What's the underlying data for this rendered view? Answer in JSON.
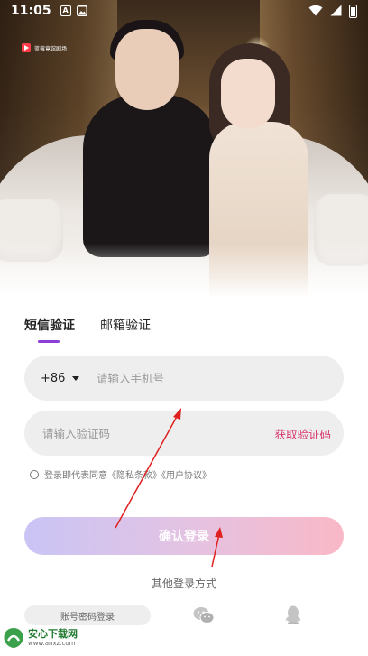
{
  "status_bar": {
    "time": "11:05",
    "app_icon_letter": "A"
  },
  "hero": {
    "brand_text": "蓝莓竟馆剧场"
  },
  "tabs": [
    {
      "label": "短信验证",
      "active": true
    },
    {
      "label": "邮箱验证",
      "active": false
    }
  ],
  "phone_field": {
    "country_code": "+86",
    "placeholder": "请输入手机号",
    "value": ""
  },
  "code_field": {
    "placeholder": "请输入验证码",
    "value": "",
    "get_code_label": "获取验证码"
  },
  "agreement": {
    "text": "登录即代表同意《隐私条款》《用户协议》",
    "checked": false
  },
  "confirm_button": {
    "label": "确认登录"
  },
  "other_login": {
    "title": "其他登录方式",
    "password_login_label": "账号密码登录",
    "icons": [
      "wechat-icon",
      "qq-icon"
    ]
  },
  "watermark": {
    "title": "安心下载网",
    "url": "www.anxz.com"
  },
  "colors": {
    "tab_indicator": "#8b3fd8",
    "get_code": "#d6336c",
    "arrow": "#e02020",
    "button_start": "#c9c4f5",
    "button_end": "#f9b8c6"
  }
}
